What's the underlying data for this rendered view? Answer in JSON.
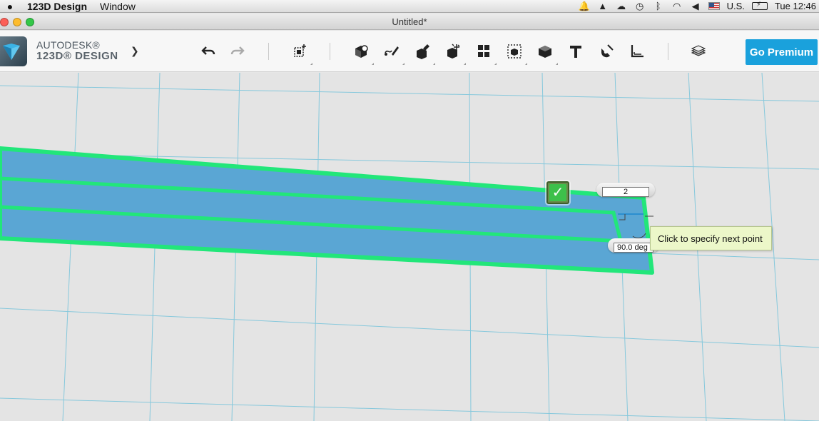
{
  "menubar": {
    "app_name": "123D Design",
    "menus": [
      "Window"
    ],
    "input_source": "U.S.",
    "clock": "Tue 12:46"
  },
  "window": {
    "title": "Untitled*"
  },
  "toolbar": {
    "brand_line1": "AUTODESK®",
    "brand_line2": "123D® DESIGN",
    "brand_menu_icon": "chevron-down-icon",
    "tools": [
      "undo-icon",
      "redo-icon",
      "primitives-icon",
      "sketch-icon",
      "construct-icon",
      "modify-icon",
      "pattern-icon",
      "group-icon",
      "combine-icon",
      "measure-icon",
      "text-icon",
      "snap-icon",
      "ruler-icon",
      "material-icon"
    ],
    "premium_label": "Go Premium",
    "premium_color": "#1aa1dc"
  },
  "viewport": {
    "length_value": "2",
    "angle_value": "90.0 deg",
    "tooltip": "Click to specify next point",
    "confirm_label": "✓",
    "highlight_color": "#22e67a",
    "fill_color": "#5aa6d4"
  }
}
